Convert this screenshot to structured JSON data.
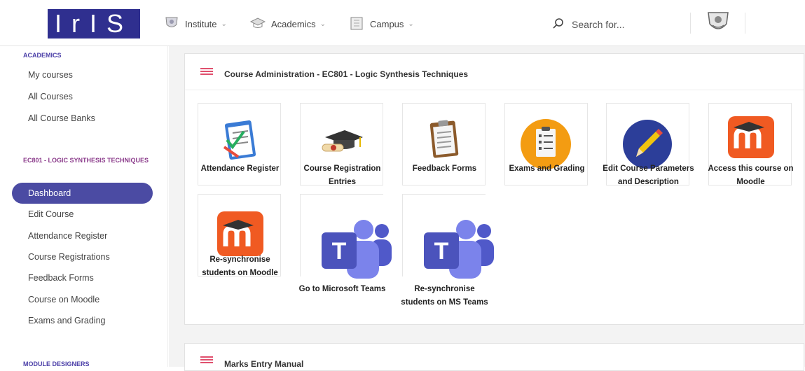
{
  "header": {
    "logo_text": "IrIS",
    "nav": [
      {
        "label": "Institute"
      },
      {
        "label": "Academics"
      },
      {
        "label": "Campus"
      }
    ],
    "search_placeholder": "Search for..."
  },
  "sidebar": {
    "section1_heading": "ACADEMICS",
    "section1_items": [
      {
        "label": "My courses"
      },
      {
        "label": "All Courses"
      },
      {
        "label": "All Course Banks"
      }
    ],
    "section2_heading": "EC801 - LOGIC SYNTHESIS TECHNIQUES",
    "active_item": "Dashboard",
    "section2_items": [
      {
        "label": "Edit Course"
      },
      {
        "label": "Attendance Register"
      },
      {
        "label": "Course Registrations"
      },
      {
        "label": "Feedback Forms"
      },
      {
        "label": "Course on Moodle"
      },
      {
        "label": "Exams and Grading"
      }
    ],
    "section3_heading": "MODULE DESIGNERS"
  },
  "main": {
    "card_title": "Course Administration - EC801 - Logic Synthesis Techniques",
    "tiles": [
      {
        "label": "Attendance Register",
        "icon": "attendance-clipboard-icon"
      },
      {
        "label": "Course Registration Entries",
        "icon": "graduation-cap-icon"
      },
      {
        "label": "Feedback Forms",
        "icon": "feedback-clipboard-icon"
      },
      {
        "label": "Exams and Grading",
        "icon": "exam-checklist-icon"
      },
      {
        "label": "Edit Course Parameters and Description",
        "icon": "pencil-icon"
      },
      {
        "label": "Access this course on Moodle",
        "icon": "moodle-icon"
      },
      {
        "label": "Re-synchronise students on Moodle",
        "icon": "moodle-icon"
      },
      {
        "label": "Go to Microsoft Teams",
        "icon": "teams-icon"
      },
      {
        "label": "Re-synchronise students on MS Teams",
        "icon": "teams-icon"
      }
    ],
    "card2_title": "Marks Entry Manual"
  },
  "colors": {
    "brand": "#2f2f8f",
    "active": "#4b4ba3",
    "accent_pink": "#e0506e",
    "moodle_orange": "#f05a22",
    "teams_purple": "#5059c9"
  }
}
